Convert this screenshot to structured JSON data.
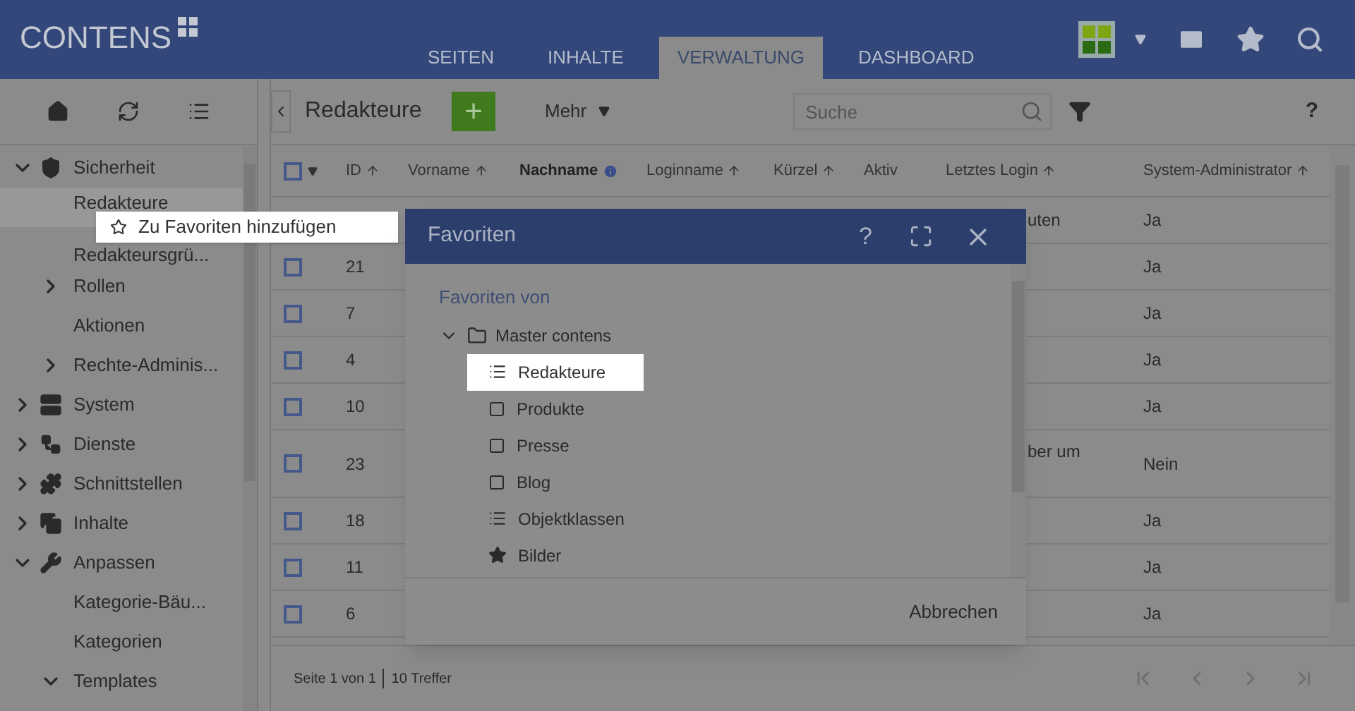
{
  "header": {
    "logo": "CONTENS",
    "tabs": [
      {
        "label": "SEITEN",
        "selected": false
      },
      {
        "label": "INHALTE",
        "selected": false
      },
      {
        "label": "VERWALTUNG",
        "selected": true
      },
      {
        "label": "DASHBOARD",
        "selected": false
      }
    ]
  },
  "sidebar": {
    "items": [
      {
        "label": "Sicherheit",
        "kind": "group",
        "expanded": true,
        "children": [
          {
            "label": "Redakteure",
            "kind": "leaf",
            "selected": true
          },
          {
            "label": "Redakteursgrü...",
            "kind": "leaf",
            "selected": false
          },
          {
            "label": "Rollen",
            "kind": "group",
            "expanded": false,
            "selected": false
          },
          {
            "label": "Aktionen",
            "kind": "leaf",
            "selected": false
          },
          {
            "label": "Rechte-Adminis...",
            "kind": "group",
            "expanded": false,
            "selected": false
          }
        ]
      },
      {
        "label": "System",
        "kind": "group",
        "expanded": false
      },
      {
        "label": "Dienste",
        "kind": "group",
        "expanded": false
      },
      {
        "label": "Schnittstellen",
        "kind": "group",
        "expanded": false
      },
      {
        "label": "Inhalte",
        "kind": "group",
        "expanded": false
      },
      {
        "label": "Anpassen",
        "kind": "group",
        "expanded": true,
        "children": [
          {
            "label": "Kategorie-Bäu...",
            "kind": "leaf",
            "selected": false
          },
          {
            "label": "Kategorien",
            "kind": "leaf",
            "selected": false
          },
          {
            "label": "Templates",
            "kind": "group",
            "expanded": true,
            "selected": false
          }
        ]
      }
    ]
  },
  "toolbar": {
    "title": "Redakteure",
    "add": "+",
    "more": "Mehr",
    "search": {
      "placeholder": "Suche"
    },
    "help": "?"
  },
  "table": {
    "columns": [
      {
        "label": "ID",
        "sortable": true,
        "bold": false
      },
      {
        "label": "Vorname",
        "sortable": true,
        "bold": false
      },
      {
        "label": "Nachname",
        "sortable": false,
        "bold": true
      },
      {
        "label": "Loginname",
        "sortable": true,
        "bold": false
      },
      {
        "label": "Kürzel",
        "sortable": true,
        "bold": false
      },
      {
        "label": "Aktiv",
        "sortable": false,
        "bold": false
      },
      {
        "label": "Letztes Login",
        "sortable": true,
        "bold": false
      },
      {
        "label": "System-Administrator",
        "sortable": true,
        "bold": false
      }
    ],
    "select_all": {
      "checked": false
    },
    "rows": [
      {
        "login": "uten",
        "admin": "Ja",
        "tall": false
      },
      {
        "id": "21",
        "admin": "Ja",
        "tall": false,
        "checked": false
      },
      {
        "id": "7",
        "admin": "Ja",
        "tall": false,
        "checked": false
      },
      {
        "id": "4",
        "admin": "Ja",
        "tall": false,
        "checked": false
      },
      {
        "id": "10",
        "admin": "Ja",
        "tall": false,
        "checked": false
      },
      {
        "id": "23",
        "login": "ber um",
        "admin": "Nein",
        "tall": true,
        "checked": false
      },
      {
        "id": "18",
        "admin": "Ja",
        "tall": false,
        "checked": false
      },
      {
        "id": "11",
        "admin": "Ja",
        "tall": false,
        "checked": false
      },
      {
        "id": "6",
        "admin": "Ja",
        "tall": false,
        "checked": false
      }
    ],
    "footer": {
      "page": "Seite 1 von 1",
      "hits": "10 Treffer"
    }
  },
  "context_menu": {
    "label": "Zu Favoriten hinzufügen"
  },
  "dialog": {
    "title": "Favoriten",
    "help": "?",
    "section": "Favoriten von",
    "root": {
      "label": "Master contens",
      "expanded": true,
      "children": [
        {
          "label": "Redakteure",
          "kind": "list",
          "selected": true
        },
        {
          "label": "Produkte",
          "kind": "page",
          "selected": false
        },
        {
          "label": "Presse",
          "kind": "page",
          "selected": false
        },
        {
          "label": "Blog",
          "kind": "page",
          "selected": false
        },
        {
          "label": "Objektklassen",
          "kind": "list",
          "selected": false
        },
        {
          "label": "Bilder",
          "kind": "star",
          "selected": false
        }
      ]
    },
    "cancel": "Abbrechen"
  }
}
